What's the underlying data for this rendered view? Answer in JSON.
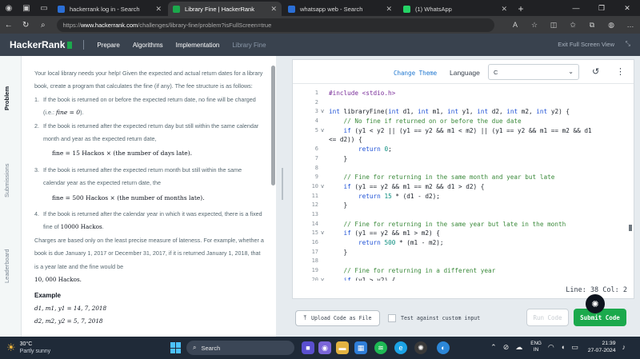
{
  "browser": {
    "tabs": [
      {
        "title": "hackerrank log in - Search",
        "favicon_color": "#2b6fd6",
        "active": false
      },
      {
        "title": "Library Fine | HackerRank",
        "favicon_color": "#1ba94c",
        "active": true
      },
      {
        "title": "whatsapp web - Search",
        "favicon_color": "#2b6fd6",
        "active": false
      },
      {
        "title": "(1) WhatsApp",
        "favicon_color": "#25d366",
        "active": false
      }
    ],
    "url_prefix": "https://",
    "url_host": "www.hackerrank.com",
    "url_path": "/challenges/library-fine/problem?isFullScreen=true"
  },
  "hr_header": {
    "logo": "HackerRank",
    "nav": [
      "Prepare",
      "Algorithms",
      "Implementation",
      "Library Fine"
    ],
    "exit_fullscreen": "Exit Full Screen View"
  },
  "side_tabs": [
    "Problem",
    "Submissions",
    "Leaderboard"
  ],
  "problem": {
    "intro": "Your local library needs your help! Given the expected and actual return dates for a library book, create a program that calculates the fine (if any). The fee structure is as follows:",
    "rules": [
      {
        "num": "1.",
        "text": "If the book is returned on or before the expected return date, no fine will be charged (i.e.: ",
        "math": "fine = 0",
        "after": ")."
      },
      {
        "num": "2.",
        "text": "If the book is returned after the expected return day but still within the same calendar month and year as the expected return date,",
        "formula": "fine = 15 Hackos × (the number of days late)."
      },
      {
        "num": "3.",
        "text": "If the book is returned after the expected return month but still within the same calendar year as the expected return date, the",
        "formula": "fine = 500 Hackos × (the number of months late)."
      },
      {
        "num": "4.",
        "text": "If the book is returned after the calendar year in which it was expected, there is a fixed fine of ",
        "math": "10000 Hackos",
        "after": "."
      }
    ],
    "charges": "Charges are based only on the least precise measure of lateness. For example, whether a book is due January 1, 2017 or December 31, 2017, if it is returned January 1, 2018, that is a year late and the fine would be",
    "charges_amount": "10, 000 Hackos.",
    "example_heading": "Example",
    "example_line1": "d1, m1, y1 = 14, 7, 2018",
    "example_line2": "d2, m2, y2 = 5, 7, 2018"
  },
  "editor": {
    "change_theme": "Change Theme",
    "language_label": "Language",
    "language_value": "C",
    "line_info": "Line: 38  Col: 2",
    "upload_label": "Upload Code as File",
    "custom_input_label": "Test against custom input",
    "run_label": "Run Code",
    "submit_label": "Submit Code",
    "code_lines": [
      {
        "n": "1",
        "fold": "",
        "text": "#include <stdio.h>"
      },
      {
        "n": "2",
        "fold": "",
        "text": ""
      },
      {
        "n": "3",
        "fold": "v",
        "text": "int libraryFine(int d1, int m1, int y1, int d2, int m2, int y2) {"
      },
      {
        "n": "4",
        "fold": "",
        "text": "    // No fine if returned on or before the due date"
      },
      {
        "n": "5",
        "fold": "v",
        "text": "    if (y1 < y2 || (y1 == y2 && m1 < m2) || (y1 == y2 && m1 == m2 && d1"
      },
      {
        "n": "",
        "fold": "",
        "text": "<= d2)) {"
      },
      {
        "n": "6",
        "fold": "",
        "text": "        return 0;"
      },
      {
        "n": "7",
        "fold": "",
        "text": "    }"
      },
      {
        "n": "8",
        "fold": "",
        "text": ""
      },
      {
        "n": "9",
        "fold": "",
        "text": "    // Fine for returning in the same month and year but late"
      },
      {
        "n": "10",
        "fold": "v",
        "text": "    if (y1 == y2 && m1 == m2 && d1 > d2) {"
      },
      {
        "n": "11",
        "fold": "",
        "text": "        return 15 * (d1 - d2);"
      },
      {
        "n": "12",
        "fold": "",
        "text": "    }"
      },
      {
        "n": "13",
        "fold": "",
        "text": ""
      },
      {
        "n": "14",
        "fold": "",
        "text": "    // Fine for returning in the same year but late in the month"
      },
      {
        "n": "15",
        "fold": "v",
        "text": "    if (y1 == y2 && m1 > m2) {"
      },
      {
        "n": "16",
        "fold": "",
        "text": "        return 500 * (m1 - m2);"
      },
      {
        "n": "17",
        "fold": "",
        "text": "    }"
      },
      {
        "n": "18",
        "fold": "",
        "text": ""
      },
      {
        "n": "19",
        "fold": "",
        "text": "    // Fine for returning in a different year"
      },
      {
        "n": "20",
        "fold": "v",
        "text": "    if (y1 > y2) {"
      }
    ]
  },
  "taskbar": {
    "temp": "30°C",
    "weather": "Partly sunny",
    "search_label": "Search",
    "lang_top": "ENG",
    "lang_bottom": "IN",
    "time": "21:39",
    "date": "27-07-2024"
  },
  "colors": {
    "hr_header": "#39424e",
    "hr_green": "#1ba94c",
    "link_blue": "#1f77d0"
  }
}
